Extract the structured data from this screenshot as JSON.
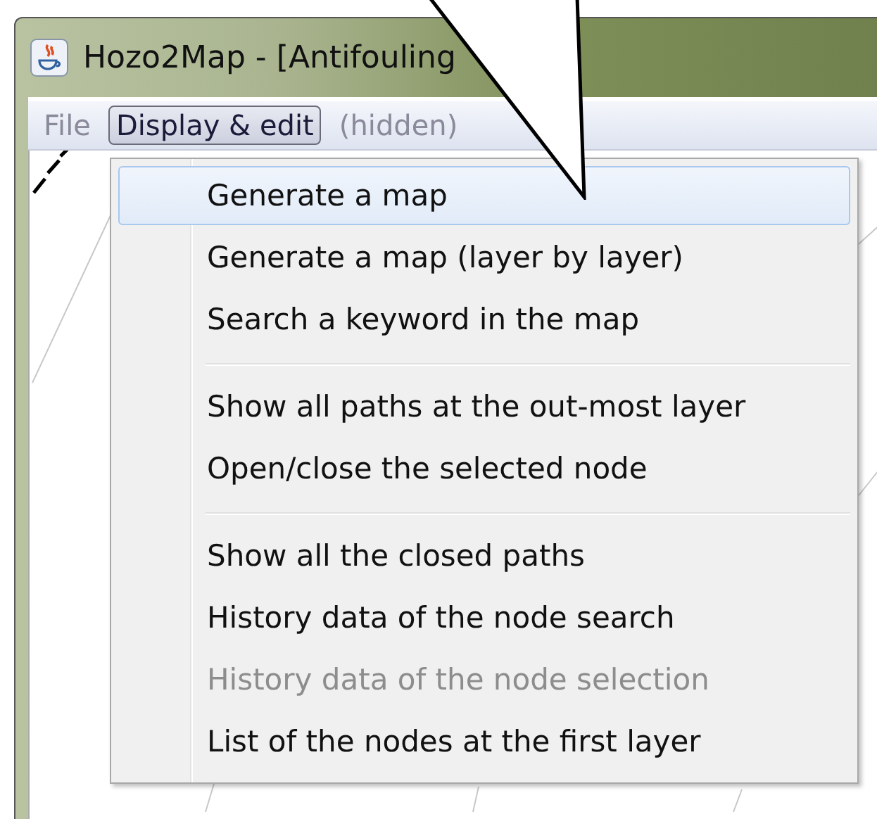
{
  "window": {
    "title": "Hozo2Map - [Antifouling"
  },
  "menu_bar": [
    {
      "label": "File",
      "selected": false
    },
    {
      "label": "Display & edit",
      "selected": true
    },
    {
      "label": "(hidden)",
      "selected": false
    }
  ],
  "dropdown": [
    {
      "kind": "item",
      "label": "Generate a map",
      "selected": true,
      "disabled": false
    },
    {
      "kind": "item",
      "label": "Generate a map (layer by layer)",
      "selected": false,
      "disabled": false
    },
    {
      "kind": "item",
      "label": "Search a keyword in the map",
      "selected": false,
      "disabled": false
    },
    {
      "kind": "separator"
    },
    {
      "kind": "item",
      "label": "Show all paths at the out-most layer",
      "selected": false,
      "disabled": false
    },
    {
      "kind": "item",
      "label": "Open/close the selected node",
      "selected": false,
      "disabled": false
    },
    {
      "kind": "separator"
    },
    {
      "kind": "item",
      "label": "Show all the closed paths",
      "selected": false,
      "disabled": false
    },
    {
      "kind": "item",
      "label": "History data of the node search",
      "selected": false,
      "disabled": false
    },
    {
      "kind": "item",
      "label": "History data of the node selection",
      "selected": false,
      "disabled": true
    },
    {
      "kind": "item",
      "label": "List of the nodes at the first layer",
      "selected": false,
      "disabled": false
    }
  ]
}
